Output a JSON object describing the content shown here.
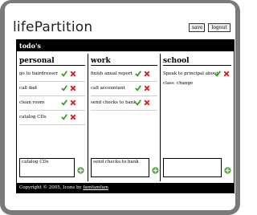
{
  "app": {
    "title": "lifePartition"
  },
  "header": {
    "save_label": "save",
    "logout_label": "logout"
  },
  "todos_title": "todo's",
  "columns": [
    {
      "title": "personal",
      "items": [
        "go to hairdresser",
        "call dad",
        "clean room",
        "catalog CDs"
      ],
      "input_value": "catalog CDs"
    },
    {
      "title": "work",
      "items": [
        "finish anual report",
        "call accountant",
        "send checks to bank"
      ],
      "input_value": "send checks to bank"
    },
    {
      "title": "school",
      "items": [
        "Speak to principal about"
      ],
      "sub_items": [
        "class",
        "change"
      ],
      "input_value": ""
    }
  ],
  "footer": {
    "text": "Copyright © 2005, Icons by",
    "link": "famfamfam"
  },
  "colors": {
    "check": "#3a9a2a",
    "cross": "#d42020",
    "add": "#5aa84a",
    "frame": "#7a7a7a"
  },
  "icons": [
    "check-icon",
    "cross-icon",
    "add-icon"
  ]
}
